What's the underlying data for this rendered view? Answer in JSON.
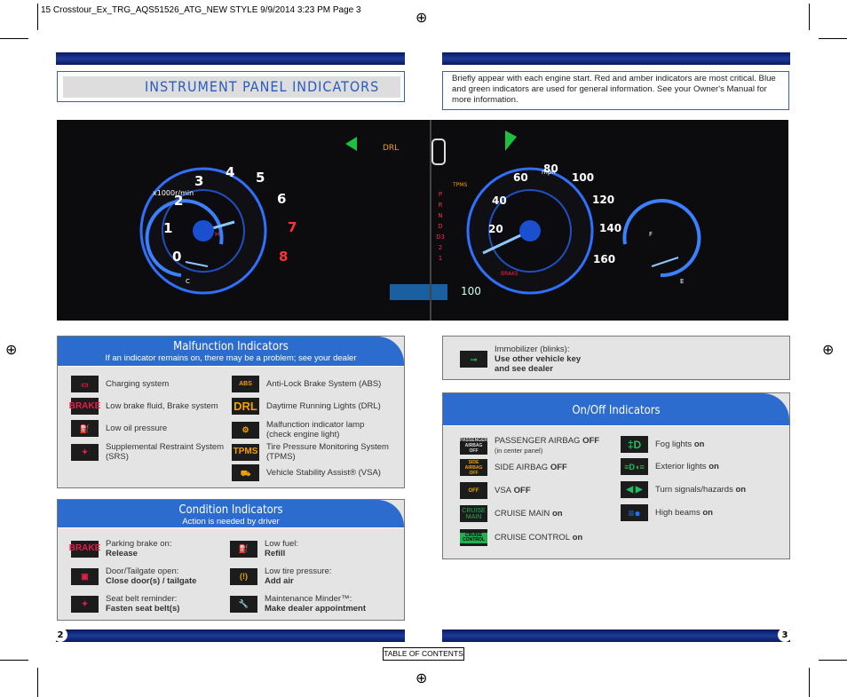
{
  "header": {
    "slug": "15 Crosstour_Ex_TRG_AQS51526_ATG_NEW STYLE  9/9/2014  3:23 PM  Page 3"
  },
  "title": "INSTRUMENT PANEL INDICATORS",
  "intro": "Briefly appear with each engine start. Red and amber indicators are most critical. Blue and green indicators are used for general information. See your Owner's Manual for more information.",
  "dash": {
    "tach_label": "x1000r/min",
    "gear": [
      "P",
      "R",
      "N",
      "D",
      "D3",
      "2",
      "1"
    ],
    "tach": [
      "0",
      "1",
      "2",
      "3",
      "4",
      "5",
      "6",
      "7",
      "8"
    ],
    "speed": [
      "20",
      "40",
      "60",
      "80",
      "100",
      "120",
      "140",
      "160"
    ],
    "odo": "100",
    "mph": "mph",
    "drl": "DRL",
    "tpms": "TPMS",
    "brake": "BRAKE",
    "temp_h": "H",
    "temp_c": "C",
    "fuel_f": "F",
    "fuel_e": "E"
  },
  "malfunction": {
    "title": "Malfunction Indicators",
    "subtitle": "If an indicator remains on, there may be a problem; see your dealer",
    "items": [
      {
        "icon": "battery-icon",
        "label": "Charging system"
      },
      {
        "icon": "brake-icon",
        "icon_text": "BRAKE",
        "label": "Low brake fluid, Brake system"
      },
      {
        "icon": "oil-can-icon",
        "label": "Low oil pressure"
      },
      {
        "icon": "airbag-icon",
        "label": "Supplemental Restraint System (SRS)"
      },
      {
        "icon": "abs-icon",
        "icon_text": "ABS",
        "label": "Anti-Lock Brake System (ABS)"
      },
      {
        "icon": "drl-icon",
        "icon_text": "DRL",
        "label": "Daytime Running Lights (DRL)"
      },
      {
        "icon": "check-engine-icon",
        "label": "Malfunction indicator lamp (check engine light)"
      },
      {
        "icon": "tpms-icon",
        "icon_text": "TPMS",
        "label": "Tire Pressure Monitoring System (TPMS)"
      },
      {
        "icon": "vsa-icon",
        "label": "Vehicle Stability Assist® (VSA)"
      }
    ]
  },
  "condition": {
    "title": "Condition Indicators",
    "subtitle": "Action is needed by driver",
    "items": [
      {
        "icon": "parking-brake-icon",
        "icon_text": "BRAKE",
        "label": "Parking brake on:",
        "action": "Release"
      },
      {
        "icon": "door-open-icon",
        "label": "Door/Tailgate open:",
        "action": "Close door(s) / tailgate"
      },
      {
        "icon": "seatbelt-icon",
        "label": "Seat belt reminder:",
        "action": "Fasten seat belt(s)"
      },
      {
        "icon": "low-fuel-icon",
        "label": "Low fuel:",
        "action": "Refill"
      },
      {
        "icon": "low-tire-pressure-icon",
        "label": "Low tire pressure:",
        "action": "Add air"
      },
      {
        "icon": "wrench-icon",
        "label": "Maintenance Minder™:",
        "action": "Make dealer appointment"
      }
    ]
  },
  "immobilizer": {
    "label": "Immobilizer (blinks):",
    "action1": "Use other vehicle key",
    "action2": "and see dealer"
  },
  "onoff": {
    "title": "On/Off Indicators",
    "items": [
      {
        "icon": "passenger-airbag-off-icon",
        "icon_text": "PASSENGER AIRBAG OFF",
        "label": "PASSENGER AIRBAG ",
        "state": "OFF",
        "note": "(in center panel)"
      },
      {
        "icon": "side-airbag-off-icon",
        "icon_text": "SIDE AIRBAG OFF",
        "label": "SIDE AIRBAG ",
        "state": "OFF"
      },
      {
        "icon": "vsa-off-icon",
        "icon_text": "OFF",
        "label": "VSA ",
        "state": "OFF"
      },
      {
        "icon": "cruise-main-icon",
        "icon_text": "CRUISE MAIN",
        "label": "CRUISE MAIN ",
        "state": "on"
      },
      {
        "icon": "cruise-control-icon",
        "icon_text": "CRUISE CONTROL",
        "label": "CRUISE CONTROL ",
        "state": "on"
      },
      {
        "icon": "fog-lights-icon",
        "label": "Fog lights ",
        "state": "on"
      },
      {
        "icon": "exterior-lights-icon",
        "label": "Exterior lights ",
        "state": "on"
      },
      {
        "icon": "turn-signals-icon",
        "label": "Turn signals/hazards ",
        "state": "on"
      },
      {
        "icon": "high-beams-icon",
        "label": "High beams ",
        "state": "on"
      }
    ]
  },
  "footer": {
    "page_left": "2",
    "page_right": "3",
    "toc": "TABLE OF CONTENTS"
  }
}
